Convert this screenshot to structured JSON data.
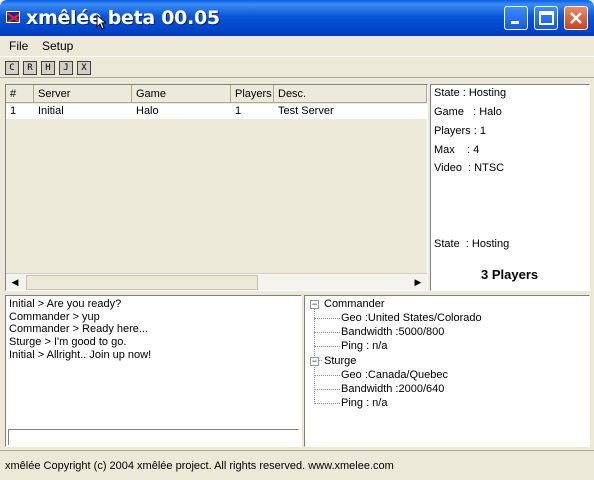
{
  "window": {
    "title": "xmêlée beta 00.05"
  },
  "menu": [
    "File",
    "Setup"
  ],
  "toolbar": [
    {
      "label": "C",
      "icon": "c-button-icon"
    },
    {
      "label": "R",
      "icon": "r-button-icon"
    },
    {
      "label": "H",
      "icon": "h-button-icon"
    },
    {
      "label": "J",
      "icon": "j-button-icon"
    },
    {
      "label": "X",
      "icon": "x-button-icon"
    }
  ],
  "server_list": {
    "columns": [
      "#",
      "Server",
      "Game",
      "Players",
      "Desc."
    ],
    "rows": [
      [
        "1",
        "Initial",
        "Halo",
        "1",
        "Test Server"
      ]
    ]
  },
  "info": {
    "state": "State : Hosting",
    "game": "Game   : Halo",
    "players": "Players : 1",
    "max": "Max    : 4",
    "video": "Video  : NTSC",
    "state2": "State  : Hosting",
    "player_total": "3 Players"
  },
  "chat": [
    "Initial > Are you ready?",
    "Commander > yup",
    "Commander > Ready here...",
    "Sturge > I'm good to go.",
    "Initial > Allright.. Join up now!"
  ],
  "tree": [
    {
      "name": "Commander",
      "details": [
        "Geo :United States/Colorado",
        "Bandwidth :5000/800",
        "Ping : n/a"
      ]
    },
    {
      "name": "Sturge",
      "details": [
        "Geo :Canada/Quebec",
        "Bandwidth :2000/640",
        "Ping : n/a"
      ]
    }
  ],
  "status": "xmêlée Copyright (c) 2004 xmêlée project. All rights reserved. www.xmelee.com",
  "colors": {
    "titlebar": "#0a56d8",
    "window": "#ece9d8",
    "close": "#c8431f"
  }
}
